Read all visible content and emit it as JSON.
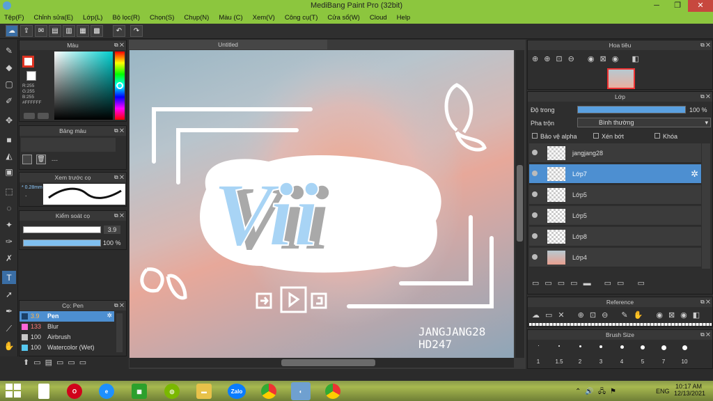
{
  "window": {
    "title": "MediBang Paint Pro (32bit)",
    "min": "─",
    "max": "❐",
    "close": "✕"
  },
  "menu": [
    "Tệp(F)",
    "Chỉnh sửa(E)",
    "Lớp(L)",
    "Bộ lọc(R)",
    "Chọn(S)",
    "Chụp(N)",
    "Màu (C)",
    "Xem(V)",
    "Công cụ(T)",
    "Cửa sổ(W)",
    "Cloud",
    "Help"
  ],
  "color_panel": {
    "title": "Màu",
    "r": "R:255",
    "g": "G:255",
    "b": "B:255",
    "hex": "#FFFFFF"
  },
  "palette_panel": {
    "title": "Bảng màu",
    "dashes": "---"
  },
  "brush_preview": {
    "title": "Xem trước cọ",
    "size": "* 0.28mm",
    "dot": "."
  },
  "brush_control": {
    "title": "Kiểm soát cọ",
    "size": "3.9",
    "opacity": "100 %",
    "size_frac": 0.75,
    "opacity_frac": 1.0
  },
  "brush_panel": {
    "title": "Cọ: Pen",
    "items": [
      {
        "size": "3.9",
        "name": "Pen",
        "color": "#1b3f66",
        "selected": true
      },
      {
        "size": "133",
        "name": "Blur",
        "color": "#ff66d9",
        "selected": false
      },
      {
        "size": "100",
        "name": "Airbrush",
        "color": "#c8c8c8",
        "selected": false
      },
      {
        "size": "100",
        "name": "Watercolor (Wet)",
        "color": "#56c8f0",
        "selected": false
      }
    ]
  },
  "document": {
    "tab": "Untitled"
  },
  "artwork": {
    "word": "Vii",
    "signature_line1": "JANGJANG28",
    "signature_line2": "HD247"
  },
  "navigator": {
    "title": "Hoa tiêu"
  },
  "layer_panel": {
    "title": "Lớp",
    "opacity_label": "Độ trong",
    "opacity_value": "100 %",
    "opacity_frac": 1.0,
    "blend_label": "Pha trộn",
    "blend_value": "Bình thường",
    "protect_alpha": "Bảo vệ alpha",
    "clipping": "Xén bớt",
    "lock": "Khóa",
    "layers": [
      {
        "name": "jangjang28",
        "selected": false
      },
      {
        "name": "Lớp7",
        "selected": true
      },
      {
        "name": "Lớp5",
        "selected": false
      },
      {
        "name": "Lớp5",
        "selected": false
      },
      {
        "name": "Lớp8",
        "selected": false
      },
      {
        "name": "Lớp4",
        "selected": false
      }
    ]
  },
  "reference_panel": {
    "title": "Reference"
  },
  "brushsize_panel": {
    "title": "Brush Size",
    "sizes": [
      "1",
      "1.5",
      "2",
      "3",
      "4",
      "5",
      "7",
      "10"
    ]
  },
  "taskbar": {
    "time": "10:17 AM",
    "date": "12/13/2021",
    "lang": "ENG",
    "zalo": "Zalo"
  },
  "colors": {
    "accent": "#4d8fd1",
    "titlebar": "#8cc63e",
    "close": "#c7483e"
  }
}
